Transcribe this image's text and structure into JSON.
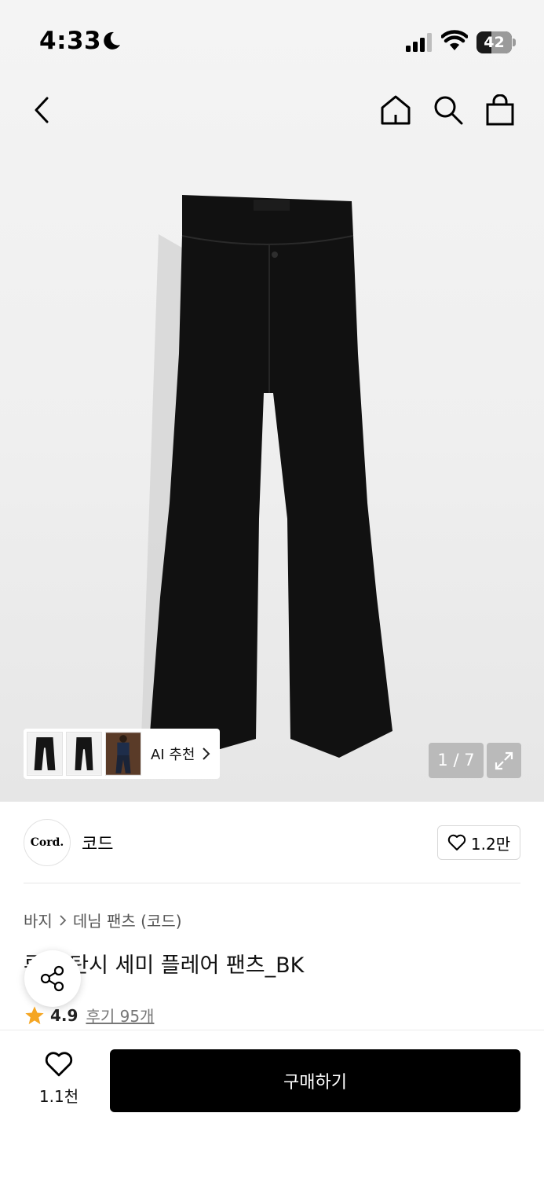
{
  "status_bar": {
    "time": "4:33",
    "battery": "42",
    "battery_level": 0.42,
    "icons": [
      "moon-icon",
      "signal-icon",
      "wifi-icon",
      "battery-icon"
    ]
  },
  "nav": {
    "icons": [
      "back-chevron-icon",
      "home-icon",
      "search-icon",
      "shopping-bag-icon"
    ]
  },
  "gallery": {
    "ai_recommend_label": "AI 추천",
    "pager": "1 / 7"
  },
  "brand": {
    "logo_text": "Cord.",
    "name": "코드",
    "like_count": "1.2만"
  },
  "breadcrumb": {
    "category": "바지",
    "subcategory": "데님 팬츠 (코드)"
  },
  "product": {
    "title": "루즈 탄시 세미 플레어 팬츠_BK",
    "rating": "4.9",
    "review_link": "후기 95개"
  },
  "bottom_bar": {
    "wish_count": "1.1천",
    "buy_label": "구매하기"
  },
  "colors": {
    "accent_star": "#F5A623",
    "buy_button_bg": "#000000"
  }
}
